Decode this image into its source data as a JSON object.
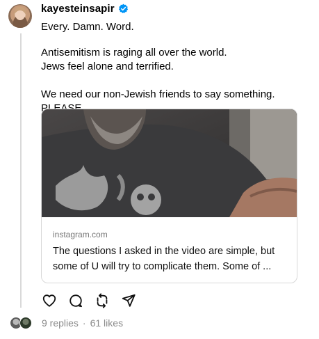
{
  "post": {
    "username": "kayesteinsapir",
    "verified": true,
    "lines": {
      "p1": "Every. Damn. Word.",
      "p2a": "Antisemitism is raging all over the world.",
      "p2b": "Jews feel alone and terrified.",
      "p3": "We need our non-Jewish friends to say something. PLEASE."
    }
  },
  "link_card": {
    "domain": "instagram.com",
    "description": "The questions I asked in the video are simple, but some of U will try to complicate them. Some of ..."
  },
  "actions": {
    "like_icon": "heart-icon",
    "comment_icon": "comment-icon",
    "repost_icon": "repost-icon",
    "share_icon": "share-icon"
  },
  "footer": {
    "replies": "9 replies",
    "separator": "·",
    "likes": "61 likes"
  },
  "colors": {
    "verified_blue": "#0095f6",
    "muted_text": "#8a8a8a",
    "thread_line": "#d9d9d9"
  }
}
